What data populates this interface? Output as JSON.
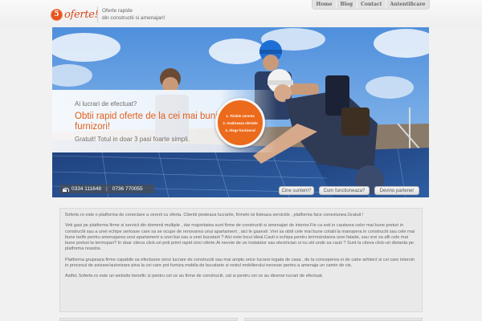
{
  "header": {
    "logo_number": "5",
    "logo_text": "oferte!",
    "tagline_line1": "Oferte rapide",
    "tagline_line2": "din constructii si amenajari!",
    "nav": [
      "Home",
      "Blog",
      "Contact",
      "Autentificare"
    ]
  },
  "hero": {
    "question": "Ai lucrari de efectuat?",
    "title": "Obtii rapid oferte de la cei mai buni furnizori!",
    "subtitle": "Gratuit! Totul in doar 3 pasi foarte simpli.",
    "steps": [
      "1. Trimite cererea",
      "2. Analizeaza ofertele",
      "3. Alege furnizorul"
    ],
    "phone1": "0334 111648",
    "phone2": "0736 770055",
    "buttons": [
      "Cine suntem?",
      "Cum functioneaza?",
      "Devino partener"
    ],
    "colors": {
      "accent": "#e35d1c",
      "sky": "#6aa4e4"
    }
  },
  "content": {
    "paragraphs": [
      "5oferte.ro este o platforma de conectare a cererii cu oferta. Clientii posteaza lucrarile, firmele isi listeaza serviciile , platforma face conexiunea.Gratuit !",
      "Veti gasi pe platforma firme si servicii din domenii multiple , dar majoritatea sunt firme de constructii si amenajari de interior.Fie ca esti in cautarea celor mai bune preturi in constructii sau a unei echipe serioase care sa se ocupe de renovarea unui apartament , aici le gasesti .Vrei sa obtii cele mai bune cotatii la manopera in constructii sau cele mai bune tarife pentru amenajarea unui apartament a unei bai sau a unei bucatarii ? Aici este locul ideal.Cauti o echipa pentru termoizolarea unei fatade, sau vrei sa afli cele mai bune preturi la termopan? In doar citeva click-uri poti primi rapid cinci oferte.Ai nevoie de un instalator sau electrician si nu stii unde sa cauti ? Sunt la citeva click-uri distanta pe platforma noastra.",
      "Platforma grupeaza firme capabile sa efectueze orice lucrare de constructii sau mai amplu orice lucrare legata de casa , de la conceperea ei de catre arhitect si cei care intervin in procesul de avizare/autorizare pina la cei care pot furniza mobila de bucatarie si restul mobilierului necesar pentru a amenaja un camin de vis.",
      "Astfel, 5oferte.ro este un website benefic si pentru cei ce au firme de constructii, cat si pentru cei ce au diverse lucrari de efectuat."
    ]
  }
}
